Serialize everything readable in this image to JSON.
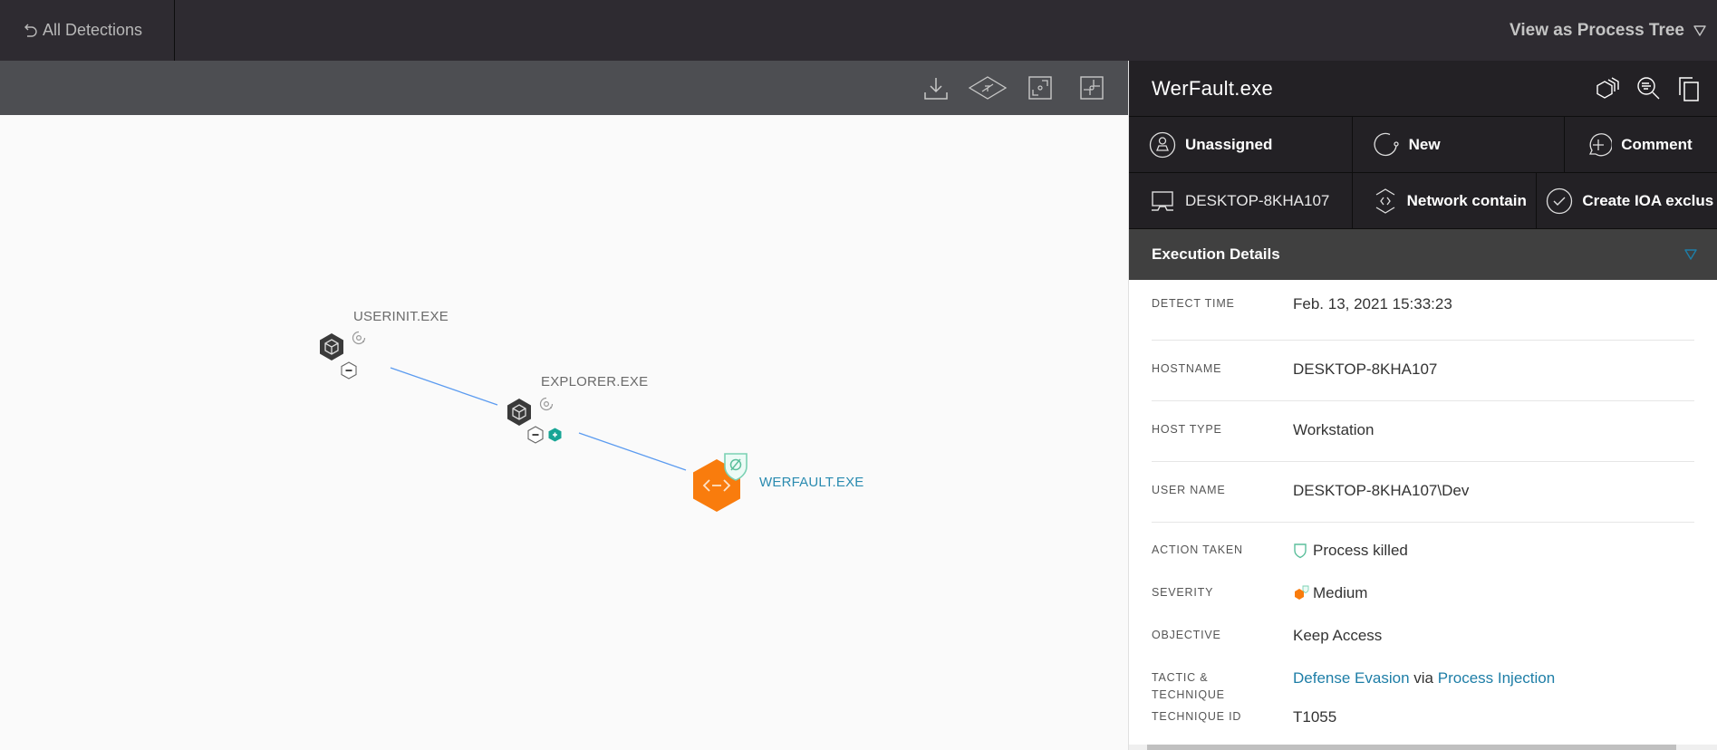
{
  "topbar": {
    "back_label": "All Detections",
    "view_label": "View as Process Tree"
  },
  "graph": {
    "toolbar": [
      "download-icon",
      "layout-icon",
      "fit-to-screen-icon",
      "collapse-icon"
    ],
    "nodes": [
      {
        "name": "USERINIT.EXE",
        "type": "process",
        "active": false
      },
      {
        "name": "EXPLORER.EXE",
        "type": "process",
        "active": false
      },
      {
        "name": "WERFAULT.EXE",
        "type": "detection",
        "active": true
      }
    ],
    "colors": {
      "edge": "#5b9bf0",
      "detection": "#f97c0d",
      "label_active": "#2a8bb0",
      "expand": "#17a595"
    }
  },
  "panel": {
    "title": "WerFault.exe",
    "actions_row1": [
      {
        "label": "Unassigned",
        "icon": "user-icon"
      },
      {
        "label": "New",
        "icon": "status-icon"
      },
      {
        "label": "Comment",
        "icon": "comment-icon"
      }
    ],
    "actions_row2": [
      {
        "label": "DESKTOP-8KHA107",
        "icon": "computer-icon"
      },
      {
        "label": "Network contain",
        "icon": "network-contain-icon"
      },
      {
        "label": "Create IOA exclus",
        "icon": "check-circle-icon"
      }
    ],
    "section_title": "Execution Details",
    "details": {
      "detect_time": {
        "key": "Detect Time",
        "value": "Feb. 13, 2021 15:33:23"
      },
      "hostname": {
        "key": "Hostname",
        "value": "DESKTOP-8KHA107"
      },
      "host_type": {
        "key": "Host Type",
        "value": "Workstation"
      },
      "user_name": {
        "key": "User Name",
        "value": "DESKTOP-8KHA107\\Dev"
      },
      "action_taken": {
        "key": "Action Taken",
        "value": "Process killed"
      },
      "severity": {
        "key": "Severity",
        "value": "Medium"
      },
      "objective": {
        "key": "Objective",
        "value": "Keep Access"
      },
      "tactic": {
        "key": "Tactic & Technique",
        "tactic": "Defense Evasion",
        "via": "via",
        "technique": "Process Injection"
      },
      "technique_id": {
        "key": "Technique ID",
        "value": "T1055"
      }
    }
  }
}
